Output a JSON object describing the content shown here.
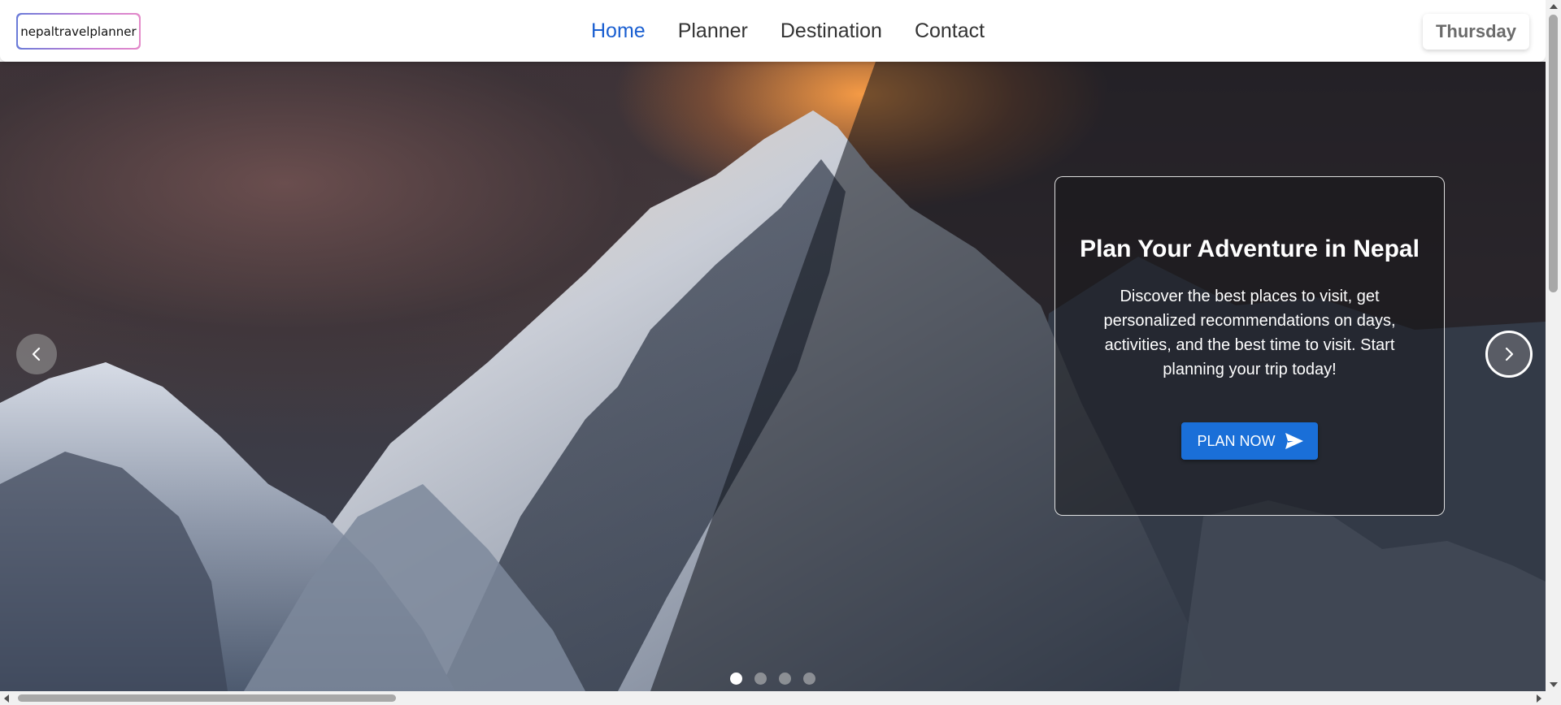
{
  "header": {
    "logo_text": "nepaltravelplanner",
    "nav": [
      {
        "label": "Home",
        "active": true
      },
      {
        "label": "Planner",
        "active": false
      },
      {
        "label": "Destination",
        "active": false
      },
      {
        "label": "Contact",
        "active": false
      }
    ],
    "day": "Thursday"
  },
  "hero": {
    "title": "Plan Your Adventure in Nepal",
    "description": "Discover the best places to visit, get personalized recommendations on days, activities, and the best time to visit. Start planning your trip today!",
    "cta_label": "PLAN NOW",
    "cta_icon": "send-icon",
    "slides": 4,
    "active_slide": 1
  },
  "colors": {
    "accent": "#1a5fd1",
    "button": "#1a6fd8",
    "day_text": "#6b6b6b"
  }
}
